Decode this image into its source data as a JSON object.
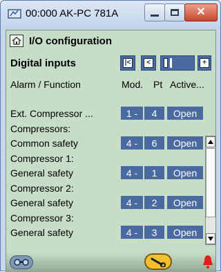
{
  "window": {
    "title": "00:000 AK-PC 781A",
    "close_glyph": "✕"
  },
  "page": {
    "title": "I/O configuration",
    "section": "Digital inputs"
  },
  "columns": {
    "function": "Alarm / Function",
    "mod": "Mod.",
    "pt": "Pt",
    "active": "Active..."
  },
  "rows": [
    {
      "label": "Ext. Compressor ...",
      "mod": "1",
      "pt": "4",
      "active": "Open"
    },
    {
      "label": "Compressors:"
    },
    {
      "label": "Common safety",
      "mod": "4",
      "pt": "6",
      "active": "Open"
    },
    {
      "label": "Compressor 1:"
    },
    {
      "label": "General safety",
      "mod": "4",
      "pt": "1",
      "active": "Open"
    },
    {
      "label": "Compressor 2:"
    },
    {
      "label": "General safety",
      "mod": "4",
      "pt": "2",
      "active": "Open"
    },
    {
      "label": "Compressor 3:"
    },
    {
      "label": "General safety",
      "mod": "4",
      "pt": "3",
      "active": "Open"
    }
  ],
  "icons": {
    "app": "monitor-icon",
    "home": "home-icon",
    "first": "first-page-icon",
    "prev": "previous-page-icon",
    "next": "next-page-icon",
    "footer_left": "binoculars-icon",
    "footer_mid": "wrench-icon",
    "footer_right": "bell-alarm-icon"
  },
  "colors": {
    "accent": "#4a6ba0",
    "panel": "#c7ddc8",
    "alarm": "#e0201a"
  }
}
